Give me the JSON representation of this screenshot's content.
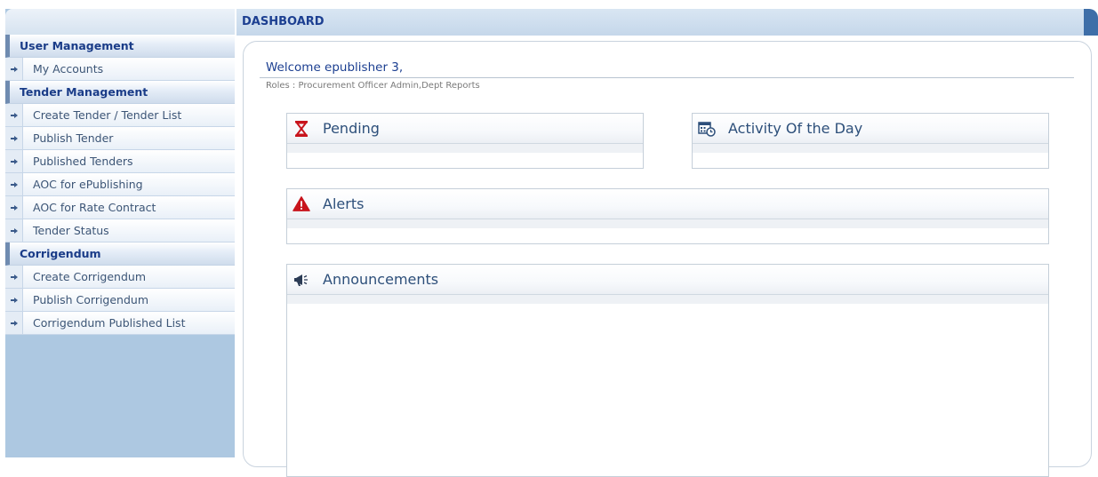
{
  "header": {
    "title": "DASHBOARD"
  },
  "sidebar": {
    "sections": [
      {
        "title": "User Management",
        "items": [
          {
            "label": "My Accounts"
          }
        ]
      },
      {
        "title": "Tender Management",
        "items": [
          {
            "label": "Create Tender / Tender List"
          },
          {
            "label": "Publish Tender"
          },
          {
            "label": "Published Tenders"
          },
          {
            "label": "AOC for ePublishing"
          },
          {
            "label": "AOC for Rate Contract"
          },
          {
            "label": "Tender Status"
          }
        ]
      },
      {
        "title": "Corrigendum",
        "items": [
          {
            "label": "Create Corrigendum"
          },
          {
            "label": "Publish Corrigendum"
          },
          {
            "label": "Corrigendum Published List"
          }
        ]
      }
    ]
  },
  "main": {
    "welcome": "Welcome epublisher 3,",
    "roles": "Roles : Procurement Officer Admin,Dept Reports",
    "widgets": {
      "pending": {
        "title": "Pending",
        "icon": "hourglass-icon"
      },
      "activity": {
        "title": "Activity Of the Day",
        "icon": "calendar-clock-icon"
      },
      "alerts": {
        "title": "Alerts",
        "icon": "warning-icon"
      },
      "announcements": {
        "title": "Announcements",
        "icon": "megaphone-icon"
      }
    }
  },
  "colors": {
    "accent": "#1c3f91",
    "sidebar_bg": "#adc8e1",
    "header_bg": "#c5d7ea"
  }
}
